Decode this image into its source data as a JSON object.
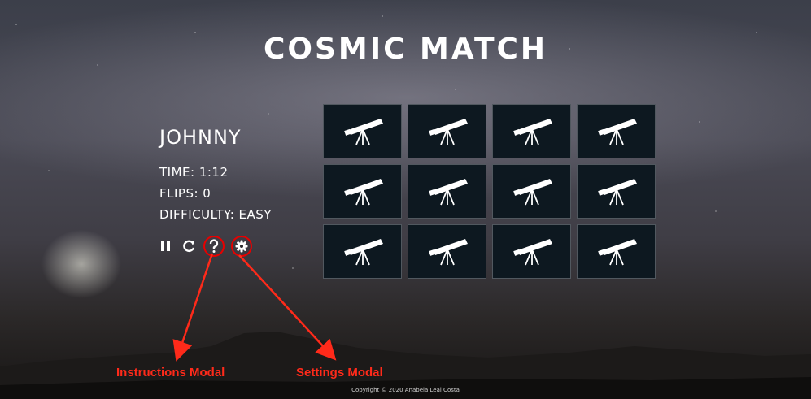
{
  "game": {
    "title": "COSMIC MATCH"
  },
  "player": {
    "name": "JOHNNY",
    "time": "TIME: 1:12",
    "flips": "FLIPS: 0",
    "difficulty": "DIFFICULTY: EASY"
  },
  "controls": [
    "pause-icon",
    "restart-icon",
    "help-icon",
    "settings-icon"
  ],
  "board": {
    "rows": 3,
    "columns": 4,
    "card_face": "telescope-icon",
    "cards_face_down": 12
  },
  "annotations": {
    "instructions": "Instructions Modal",
    "settings": "Settings Modal",
    "color": "#ff2a1a"
  },
  "footer": {
    "text": "Copyright © 2020 Anabela Leal Costa"
  }
}
